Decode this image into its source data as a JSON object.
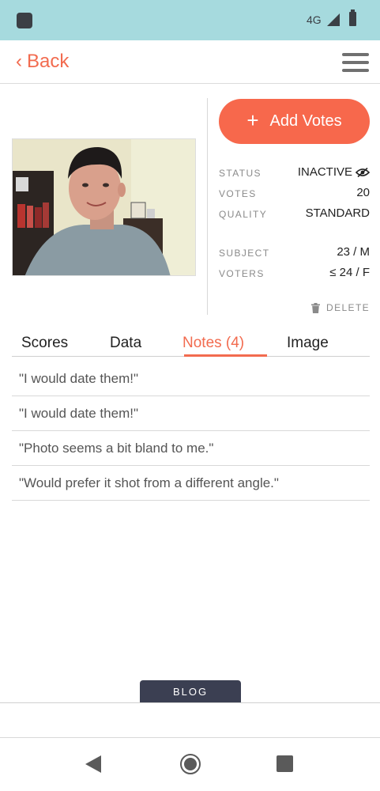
{
  "status_bar": {
    "network": "4G"
  },
  "header": {
    "back_label": "Back"
  },
  "actions": {
    "add_votes_label": "Add Votes"
  },
  "info": {
    "status_label": "STATUS",
    "status_value": "INACTIVE",
    "votes_label": "VOTES",
    "votes_value": "20",
    "quality_label": "QUALITY",
    "quality_value": "STANDARD",
    "subject_label": "SUBJECT",
    "subject_value": "23 / M",
    "voters_label": "VOTERS",
    "voters_value": "≤ 24 / F"
  },
  "delete_label": "DELETE",
  "tabs": [
    {
      "label": "Scores"
    },
    {
      "label": "Data"
    },
    {
      "label": "Notes (4)",
      "active": true
    },
    {
      "label": "Image"
    }
  ],
  "notes": [
    "\"I would date them!\"",
    "\"I would date them!\"",
    "\"Photo seems a bit bland to me.\"",
    "\"Would prefer it shot from a different angle.\""
  ],
  "blog_label": "BLOG",
  "colors": {
    "accent": "#f7684c",
    "status_bar": "#a6dade",
    "blog_bg": "#3b3f52"
  }
}
